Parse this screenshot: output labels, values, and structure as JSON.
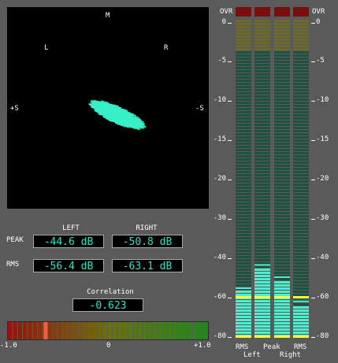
{
  "scope": {
    "label_top": "M",
    "label_left": "L",
    "label_right": "R",
    "label_plus_side": "+S",
    "label_minus_side": "-S",
    "trace_color": "#39f0c8"
  },
  "levels": {
    "left_header": "LEFT",
    "right_header": "RIGHT",
    "peak_label": "PEAK",
    "rms_label": "RMS",
    "peak_left": "-44.6 dB",
    "peak_right": "-50.8 dB",
    "rms_left": "-56.4 dB",
    "rms_right": "-63.1 dB"
  },
  "correlation": {
    "label": "Correlation",
    "value": "-0.623",
    "scale_min": "-1.0",
    "scale_mid": "0",
    "scale_max": "+1.0",
    "marker_value": -0.623
  },
  "meter": {
    "ovr_label": "OVR",
    "ticks": [
      "0",
      "-5",
      "-10",
      "-15",
      "-20",
      "-25",
      "-30",
      "-35",
      "-40",
      "-45",
      "-50",
      "-60",
      "-70",
      "-80"
    ],
    "bottom_labels": [
      {
        "top": "RMS",
        "bottom": "Left"
      },
      {
        "top": "Peak",
        "bottom": ""
      },
      {
        "top": "RMS",
        "bottom": "Right"
      }
    ],
    "channels": [
      {
        "name": "RMS Left",
        "level_db": -56.4
      },
      {
        "name": "Peak Left",
        "level_db": -44.6
      },
      {
        "name": "Peak Right",
        "level_db": -50.8
      },
      {
        "name": "RMS Right",
        "level_db": -63.1
      }
    ],
    "colors": {
      "ovr": "#7a0e0e",
      "lit": "#4af0d0",
      "unlit": "#1f5040",
      "warn_unlit": "#6b6a2a",
      "marker": "#ffff33"
    }
  }
}
